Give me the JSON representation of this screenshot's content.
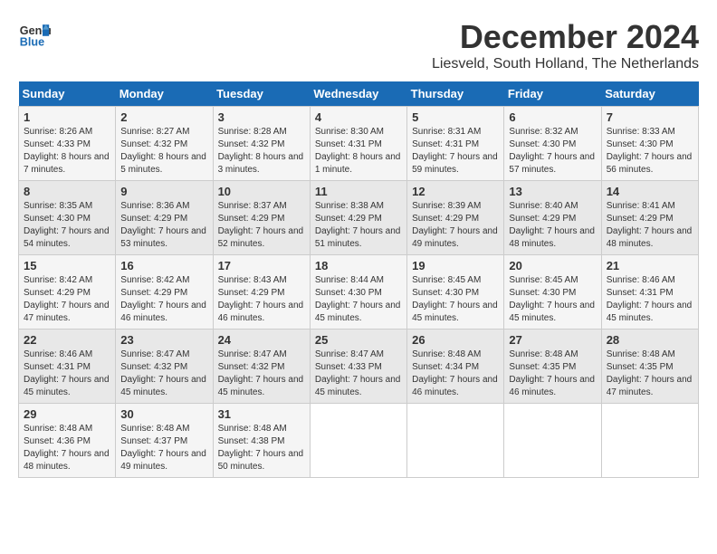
{
  "logo": {
    "line1": "General",
    "line2": "Blue"
  },
  "title": "December 2024",
  "subtitle": "Liesveld, South Holland, The Netherlands",
  "days_of_week": [
    "Sunday",
    "Monday",
    "Tuesday",
    "Wednesday",
    "Thursday",
    "Friday",
    "Saturday"
  ],
  "weeks": [
    [
      {
        "day": "1",
        "sunrise": "8:26 AM",
        "sunset": "4:33 PM",
        "daylight": "8 hours and 7 minutes."
      },
      {
        "day": "2",
        "sunrise": "8:27 AM",
        "sunset": "4:32 PM",
        "daylight": "8 hours and 5 minutes."
      },
      {
        "day": "3",
        "sunrise": "8:28 AM",
        "sunset": "4:32 PM",
        "daylight": "8 hours and 3 minutes."
      },
      {
        "day": "4",
        "sunrise": "8:30 AM",
        "sunset": "4:31 PM",
        "daylight": "8 hours and 1 minute."
      },
      {
        "day": "5",
        "sunrise": "8:31 AM",
        "sunset": "4:31 PM",
        "daylight": "7 hours and 59 minutes."
      },
      {
        "day": "6",
        "sunrise": "8:32 AM",
        "sunset": "4:30 PM",
        "daylight": "7 hours and 57 minutes."
      },
      {
        "day": "7",
        "sunrise": "8:33 AM",
        "sunset": "4:30 PM",
        "daylight": "7 hours and 56 minutes."
      }
    ],
    [
      {
        "day": "8",
        "sunrise": "8:35 AM",
        "sunset": "4:30 PM",
        "daylight": "7 hours and 54 minutes."
      },
      {
        "day": "9",
        "sunrise": "8:36 AM",
        "sunset": "4:29 PM",
        "daylight": "7 hours and 53 minutes."
      },
      {
        "day": "10",
        "sunrise": "8:37 AM",
        "sunset": "4:29 PM",
        "daylight": "7 hours and 52 minutes."
      },
      {
        "day": "11",
        "sunrise": "8:38 AM",
        "sunset": "4:29 PM",
        "daylight": "7 hours and 51 minutes."
      },
      {
        "day": "12",
        "sunrise": "8:39 AM",
        "sunset": "4:29 PM",
        "daylight": "7 hours and 49 minutes."
      },
      {
        "day": "13",
        "sunrise": "8:40 AM",
        "sunset": "4:29 PM",
        "daylight": "7 hours and 48 minutes."
      },
      {
        "day": "14",
        "sunrise": "8:41 AM",
        "sunset": "4:29 PM",
        "daylight": "7 hours and 48 minutes."
      }
    ],
    [
      {
        "day": "15",
        "sunrise": "8:42 AM",
        "sunset": "4:29 PM",
        "daylight": "7 hours and 47 minutes."
      },
      {
        "day": "16",
        "sunrise": "8:42 AM",
        "sunset": "4:29 PM",
        "daylight": "7 hours and 46 minutes."
      },
      {
        "day": "17",
        "sunrise": "8:43 AM",
        "sunset": "4:29 PM",
        "daylight": "7 hours and 46 minutes."
      },
      {
        "day": "18",
        "sunrise": "8:44 AM",
        "sunset": "4:30 PM",
        "daylight": "7 hours and 45 minutes."
      },
      {
        "day": "19",
        "sunrise": "8:45 AM",
        "sunset": "4:30 PM",
        "daylight": "7 hours and 45 minutes."
      },
      {
        "day": "20",
        "sunrise": "8:45 AM",
        "sunset": "4:30 PM",
        "daylight": "7 hours and 45 minutes."
      },
      {
        "day": "21",
        "sunrise": "8:46 AM",
        "sunset": "4:31 PM",
        "daylight": "7 hours and 45 minutes."
      }
    ],
    [
      {
        "day": "22",
        "sunrise": "8:46 AM",
        "sunset": "4:31 PM",
        "daylight": "7 hours and 45 minutes."
      },
      {
        "day": "23",
        "sunrise": "8:47 AM",
        "sunset": "4:32 PM",
        "daylight": "7 hours and 45 minutes."
      },
      {
        "day": "24",
        "sunrise": "8:47 AM",
        "sunset": "4:32 PM",
        "daylight": "7 hours and 45 minutes."
      },
      {
        "day": "25",
        "sunrise": "8:47 AM",
        "sunset": "4:33 PM",
        "daylight": "7 hours and 45 minutes."
      },
      {
        "day": "26",
        "sunrise": "8:48 AM",
        "sunset": "4:34 PM",
        "daylight": "7 hours and 46 minutes."
      },
      {
        "day": "27",
        "sunrise": "8:48 AM",
        "sunset": "4:35 PM",
        "daylight": "7 hours and 46 minutes."
      },
      {
        "day": "28",
        "sunrise": "8:48 AM",
        "sunset": "4:35 PM",
        "daylight": "7 hours and 47 minutes."
      }
    ],
    [
      {
        "day": "29",
        "sunrise": "8:48 AM",
        "sunset": "4:36 PM",
        "daylight": "7 hours and 48 minutes."
      },
      {
        "day": "30",
        "sunrise": "8:48 AM",
        "sunset": "4:37 PM",
        "daylight": "7 hours and 49 minutes."
      },
      {
        "day": "31",
        "sunrise": "8:48 AM",
        "sunset": "4:38 PM",
        "daylight": "7 hours and 50 minutes."
      },
      null,
      null,
      null,
      null
    ]
  ],
  "labels": {
    "sunrise": "Sunrise:",
    "sunset": "Sunset:",
    "daylight": "Daylight:"
  }
}
